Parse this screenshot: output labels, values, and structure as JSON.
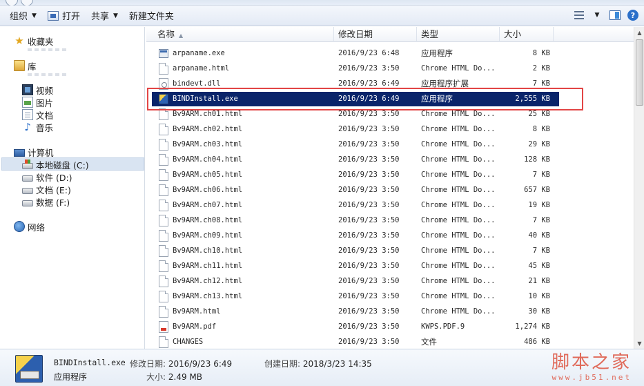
{
  "toolbar": {
    "organize_label": "组织",
    "open_label": "打开",
    "share_label": "共享",
    "new_folder_label": "新建文件夹"
  },
  "nav": {
    "favorites": "收藏夹",
    "libraries": "库",
    "library_items": [
      "视频",
      "图片",
      "文档",
      "音乐"
    ],
    "computer": "计算机",
    "drives": [
      "本地磁盘 (C:)",
      "软件 (D:)",
      "文档 (E:)",
      "数据 (F:)"
    ],
    "network": "网络"
  },
  "columns": {
    "name": "名称",
    "date": "修改日期",
    "type": "类型",
    "size": "大小"
  },
  "files": [
    {
      "name": "arpaname.exe",
      "date": "2016/9/23 6:48",
      "type": "应用程序",
      "size": "8 KB",
      "icon": "exe-icon"
    },
    {
      "name": "arpaname.html",
      "date": "2016/9/23 3:50",
      "type": "Chrome HTML Do...",
      "size": "2 KB",
      "icon": "html-file-icon"
    },
    {
      "name": "bindevt.dll",
      "date": "2016/9/23 6:49",
      "type": "应用程序扩展",
      "size": "7 KB",
      "icon": "dll-icon"
    },
    {
      "name": "BINDInstall.exe",
      "date": "2016/9/23 6:49",
      "type": "应用程序",
      "size": "2,555 KB",
      "icon": "setup-icon",
      "selected": true
    },
    {
      "name": "Bv9ARM.ch01.html",
      "date": "2016/9/23 3:50",
      "type": "Chrome HTML Do...",
      "size": "25 KB",
      "icon": "html-file-icon"
    },
    {
      "name": "Bv9ARM.ch02.html",
      "date": "2016/9/23 3:50",
      "type": "Chrome HTML Do...",
      "size": "8 KB",
      "icon": "html-file-icon"
    },
    {
      "name": "Bv9ARM.ch03.html",
      "date": "2016/9/23 3:50",
      "type": "Chrome HTML Do...",
      "size": "29 KB",
      "icon": "html-file-icon"
    },
    {
      "name": "Bv9ARM.ch04.html",
      "date": "2016/9/23 3:50",
      "type": "Chrome HTML Do...",
      "size": "128 KB",
      "icon": "html-file-icon"
    },
    {
      "name": "Bv9ARM.ch05.html",
      "date": "2016/9/23 3:50",
      "type": "Chrome HTML Do...",
      "size": "7 KB",
      "icon": "html-file-icon"
    },
    {
      "name": "Bv9ARM.ch06.html",
      "date": "2016/9/23 3:50",
      "type": "Chrome HTML Do...",
      "size": "657 KB",
      "icon": "html-file-icon"
    },
    {
      "name": "Bv9ARM.ch07.html",
      "date": "2016/9/23 3:50",
      "type": "Chrome HTML Do...",
      "size": "19 KB",
      "icon": "html-file-icon"
    },
    {
      "name": "Bv9ARM.ch08.html",
      "date": "2016/9/23 3:50",
      "type": "Chrome HTML Do...",
      "size": "7 KB",
      "icon": "html-file-icon"
    },
    {
      "name": "Bv9ARM.ch09.html",
      "date": "2016/9/23 3:50",
      "type": "Chrome HTML Do...",
      "size": "40 KB",
      "icon": "html-file-icon"
    },
    {
      "name": "Bv9ARM.ch10.html",
      "date": "2016/9/23 3:50",
      "type": "Chrome HTML Do...",
      "size": "7 KB",
      "icon": "html-file-icon"
    },
    {
      "name": "Bv9ARM.ch11.html",
      "date": "2016/9/23 3:50",
      "type": "Chrome HTML Do...",
      "size": "45 KB",
      "icon": "html-file-icon"
    },
    {
      "name": "Bv9ARM.ch12.html",
      "date": "2016/9/23 3:50",
      "type": "Chrome HTML Do...",
      "size": "21 KB",
      "icon": "html-file-icon"
    },
    {
      "name": "Bv9ARM.ch13.html",
      "date": "2016/9/23 3:50",
      "type": "Chrome HTML Do...",
      "size": "10 KB",
      "icon": "html-file-icon"
    },
    {
      "name": "Bv9ARM.html",
      "date": "2016/9/23 3:50",
      "type": "Chrome HTML Do...",
      "size": "30 KB",
      "icon": "html-file-icon"
    },
    {
      "name": "Bv9ARM.pdf",
      "date": "2016/9/23 3:50",
      "type": "KWPS.PDF.9",
      "size": "1,274 KB",
      "icon": "pdf-icon"
    },
    {
      "name": "CHANGES",
      "date": "2016/9/23 3:50",
      "type": "文件",
      "size": "486 KB",
      "icon": "file-icon"
    }
  ],
  "details": {
    "file_name": "BINDInstall.exe",
    "modified_label": "修改日期:",
    "modified_value": "2016/9/23 6:49",
    "created_label": "创建日期:",
    "created_value": "2018/3/23 14:35",
    "type_value": "应用程序",
    "size_label": "大小:",
    "size_value": "2.49 MB"
  },
  "watermark": {
    "title": "脚本之家",
    "url": "www.jb51.net"
  },
  "colors": {
    "selection": "#0a246a",
    "highlight_box": "#e24545",
    "watermark": "#e06a5a"
  }
}
